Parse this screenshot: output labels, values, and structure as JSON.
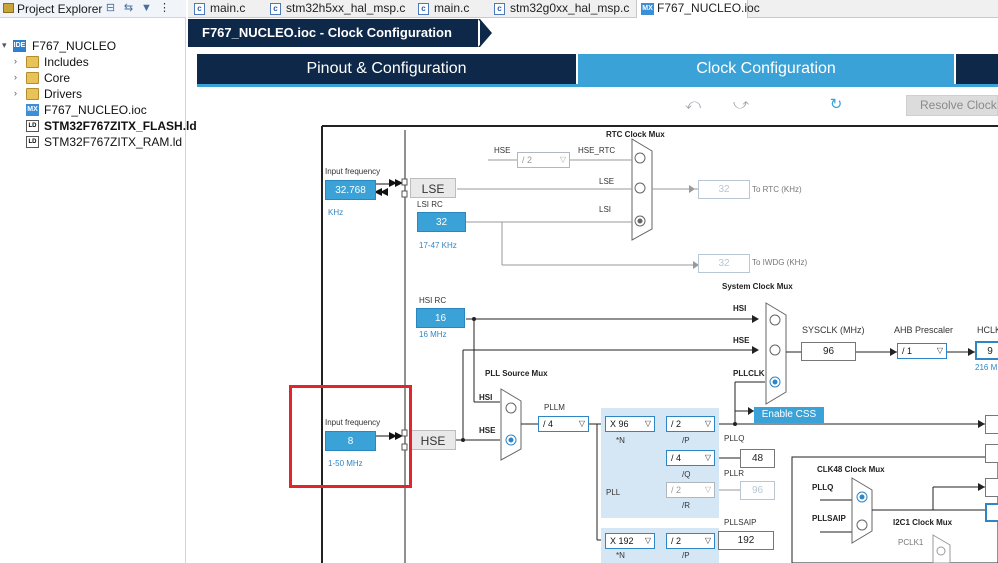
{
  "explorer": {
    "title": "Project Explorer",
    "tree": [
      {
        "label": "F767_NUCLEO",
        "kind": "project"
      },
      {
        "label": "Includes",
        "kind": "folder"
      },
      {
        "label": "Core",
        "kind": "folder"
      },
      {
        "label": "Drivers",
        "kind": "folder"
      },
      {
        "label": "F767_NUCLEO.ioc",
        "kind": "ioc"
      },
      {
        "label": "STM32F767ZITX_FLASH.ld",
        "kind": "ld"
      },
      {
        "label": "STM32F767ZITX_RAM.ld",
        "kind": "ld"
      }
    ]
  },
  "editor_tabs": [
    "main.c",
    "stm32h5xx_hal_msp.c",
    "main.c",
    "stm32g0xx_hal_msp.c",
    "F767_NUCLEO.ioc"
  ],
  "title": "F767_NUCLEO.ioc - Clock Configuration",
  "main_tabs": [
    "Pinout & Configuration",
    "Clock Configuration"
  ],
  "toolbar": {
    "resolve": "Resolve Clock Issues"
  },
  "diagram": {
    "rtc_mux": "RTC Clock Mux",
    "input_frequency": "Input frequency",
    "lse_freq": "32.768",
    "khz": "KHz",
    "lse": "LSE",
    "lsi_rc": "LSI RC",
    "lsi_val": "32",
    "lsi_range": "17-47 KHz",
    "hse_lbl": "HSE",
    "rtc_div": "/ 2",
    "hse_rtc": "HSE_RTC",
    "lse_lbl": "LSE",
    "lsi_lbl": "LSI",
    "to_rtc_val": "32",
    "to_rtc": "To RTC (KHz)",
    "to_iwdg_val": "32",
    "to_iwdg": "To IWDG (KHz)",
    "hsi_rc": "HSI RC",
    "hsi_val": "16",
    "hsi_mhz": "16 MHz",
    "sys_mux": "System Clock Mux",
    "hsi": "HSI",
    "hse": "HSE",
    "pllclk": "PLLCLK",
    "sysclk": "SYSCLK (MHz)",
    "sysclk_val": "96",
    "ahb": "AHB Prescaler",
    "ahb_val": "/ 1",
    "hclk": "HCLK",
    "hclk_val": "9",
    "mhz216": "216 M",
    "enable_css": "Enable CSS",
    "pll_src": "PLL Source Mux",
    "pllm": "PLLM",
    "pllm_val": "/ 4",
    "hse_freq": "8",
    "hse_range": "1-50 MHz",
    "hse_box": "HSE",
    "n_val": "X 96",
    "n_lbl": "*N",
    "p_val": "/ 2",
    "p_lbl": "/P",
    "q_val": "/ 4",
    "q_lbl": "/Q",
    "r_val": "/ 2",
    "r_lbl": "/R",
    "pllq": "PLLQ",
    "pllq_val": "48",
    "pllr": "PLLR",
    "pllr_val": "96",
    "pll": "PLL",
    "pllsaip": "PLLSAIP",
    "pllsaip_val": "192",
    "n2_val": "X 192",
    "p2_val": "/ 2",
    "clk48": "CLK48 Clock Mux",
    "pllq_in": "PLLQ",
    "pllsaip_in": "PLLSAIP",
    "i2c1": "I2C1 Clock Mux",
    "pclk1": "PCLK1"
  },
  "colors": {
    "navy": "#0d2848",
    "accent": "#3ba2d8",
    "highlight": "#e0262c"
  }
}
